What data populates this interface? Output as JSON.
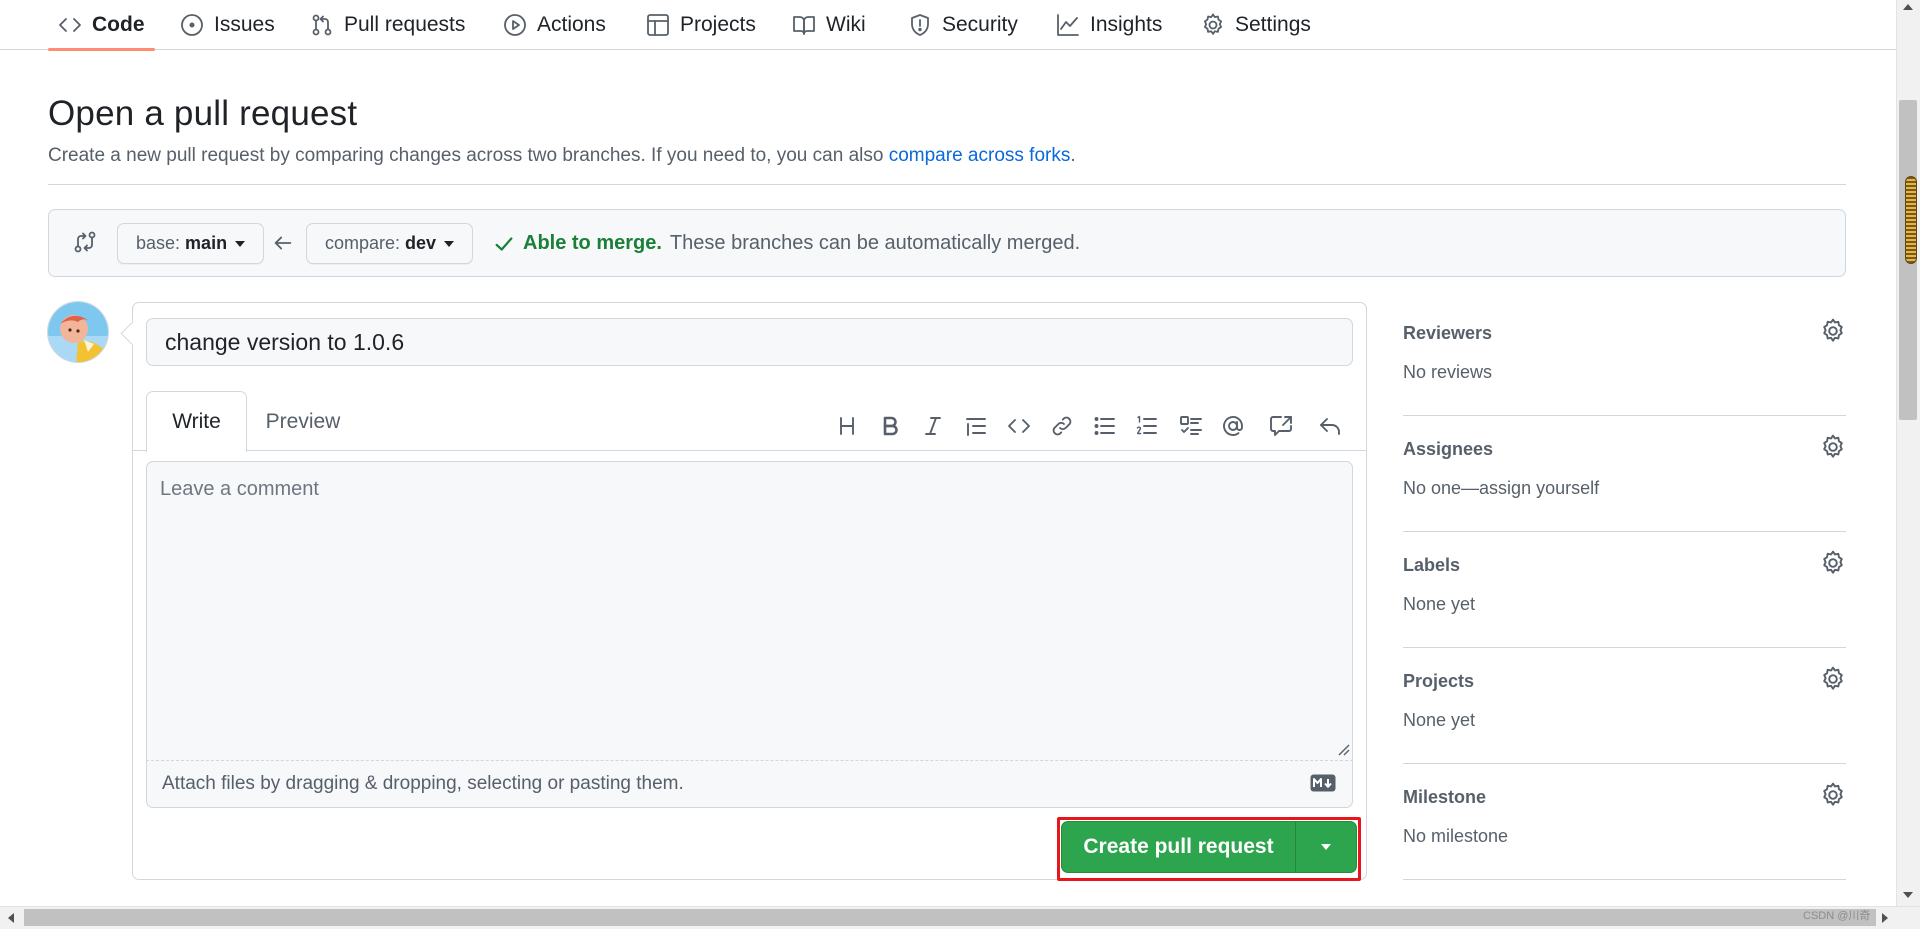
{
  "nav": {
    "items": [
      {
        "label": "Code",
        "icon": "code-icon",
        "active": true
      },
      {
        "label": "Issues",
        "icon": "issue-icon",
        "active": false
      },
      {
        "label": "Pull requests",
        "icon": "pull-request-icon",
        "active": false
      },
      {
        "label": "Actions",
        "icon": "play-icon",
        "active": false
      },
      {
        "label": "Projects",
        "icon": "table-icon",
        "active": false
      },
      {
        "label": "Wiki",
        "icon": "book-icon",
        "active": false
      },
      {
        "label": "Security",
        "icon": "shield-icon",
        "active": false
      },
      {
        "label": "Insights",
        "icon": "graph-icon",
        "active": false
      },
      {
        "label": "Settings",
        "icon": "gear-icon",
        "active": false
      }
    ]
  },
  "header": {
    "title": "Open a pull request",
    "description": "Create a new pull request by comparing changes across two branches. If you need to, you can also",
    "link_text": "compare across forks",
    "link_suffix": "."
  },
  "compare": {
    "base_prefix": "base:",
    "base_branch": "main",
    "compare_prefix": "compare:",
    "compare_branch": "dev",
    "status_ok": "Able to merge.",
    "status_text": "These branches can be automatically merged."
  },
  "editor": {
    "title_value": "change version to 1.0.6",
    "tabs": [
      "Write",
      "Preview"
    ],
    "toolbar": [
      "heading-icon",
      "bold-icon",
      "italic-icon",
      "quote-icon",
      "code-icon",
      "link-icon",
      "bullet-list-icon",
      "numbered-list-icon",
      "task-list-icon",
      "mention-icon",
      "cross-reference-icon",
      "reply-icon"
    ],
    "comment_placeholder": "Leave a comment",
    "attach_text": "Attach files by dragging & dropping, selecting or pasting them.",
    "submit_label": "Create pull request"
  },
  "sidebar": {
    "sections": [
      {
        "title": "Reviewers",
        "value": "No reviews"
      },
      {
        "title": "Assignees",
        "value": "No one—assign yourself"
      },
      {
        "title": "Labels",
        "value": "None yet"
      },
      {
        "title": "Projects",
        "value": "None yet"
      },
      {
        "title": "Milestone",
        "value": "No milestone"
      }
    ]
  },
  "watermark": "CSDN @川奇",
  "colors": {
    "accent_green": "#2da44e",
    "link_blue": "#0969da",
    "merge_green": "#1a7f37",
    "highlight_red": "#e8161c",
    "active_tab_underline": "#fd8c73"
  }
}
